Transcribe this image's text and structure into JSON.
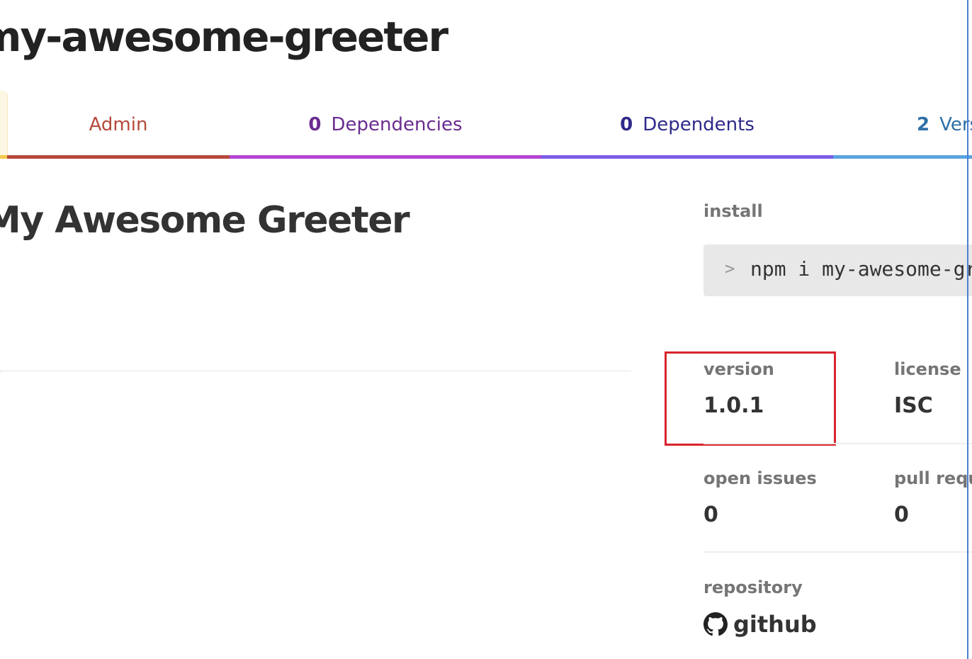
{
  "package": {
    "title": "my-awesome-greeter",
    "readme_title": "My Awesome Greeter"
  },
  "tabs": {
    "admin": {
      "label": "Admin"
    },
    "dependencies": {
      "count": "0",
      "label": "Dependencies"
    },
    "dependents": {
      "count": "0",
      "label": "Dependents"
    },
    "versions": {
      "count": "2",
      "label": "Versions"
    }
  },
  "sidebar": {
    "install_label": "install",
    "install_prompt": ">",
    "install_command": "npm i my-awesome-greeter",
    "version_label": "version",
    "version_value": "1.0.1",
    "license_label": "license",
    "license_value": "ISC",
    "open_issues_label": "open issues",
    "open_issues_value": "0",
    "pull_requests_label": "pull requests",
    "pull_requests_value": "0",
    "repository_label": "repository",
    "repository_value": "github",
    "repository_icon": "github-icon"
  },
  "colors": {
    "admin_tab": "#b5493b",
    "dependencies_tab": "#b546d4",
    "dependents_tab": "#7b5ce8",
    "versions_tab": "#5aa4e0",
    "highlight": "#d9232e"
  }
}
